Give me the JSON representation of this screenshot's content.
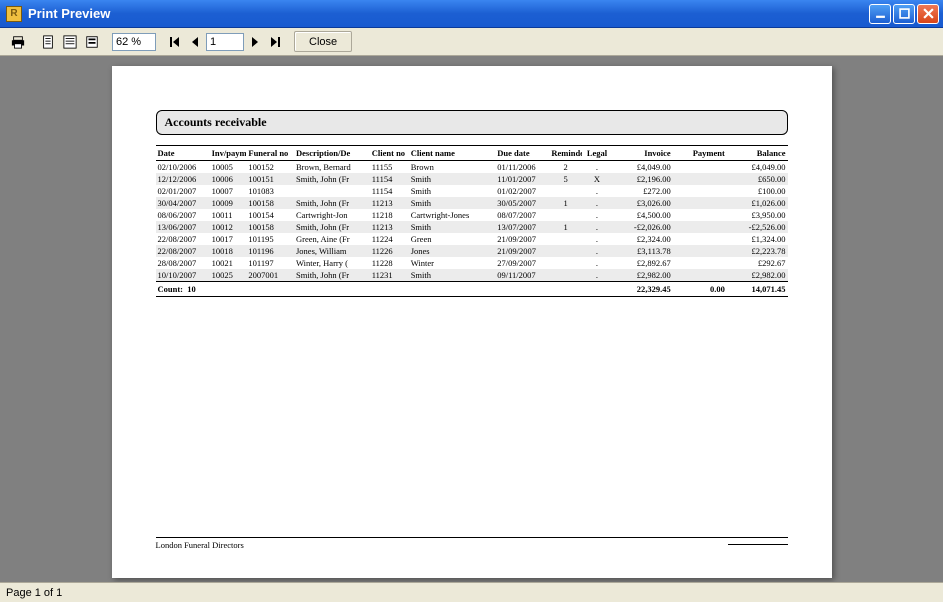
{
  "window": {
    "title": "Print Preview"
  },
  "toolbar": {
    "zoom": "62 %",
    "page": "1",
    "close_label": "Close"
  },
  "status": {
    "text": "Page 1 of 1"
  },
  "report": {
    "title": "Accounts receivable",
    "columns": [
      "Date",
      "Inv/paym.no",
      "Funeral no",
      "Description/De",
      "Client no",
      "Client name",
      "Due date",
      "Reminder",
      "Legal",
      "Invoice",
      "Payment",
      "Balance"
    ],
    "rows": [
      {
        "date": "02/10/2006",
        "inv": "10005",
        "funeral": "100152",
        "desc": "Brown, Bernard",
        "client": "11155",
        "cname": "Brown",
        "due": "01/11/2006",
        "rem": "2",
        "legal": ".",
        "invoice": "£4,049.00",
        "payment": "",
        "balance": "£4,049.00"
      },
      {
        "date": "12/12/2006",
        "inv": "10006",
        "funeral": "100151",
        "desc": "Smith, John (Fr",
        "client": "11154",
        "cname": "Smith",
        "due": "11/01/2007",
        "rem": "5",
        "legal": "X",
        "invoice": "£2,196.00",
        "payment": "",
        "balance": "£650.00"
      },
      {
        "date": "02/01/2007",
        "inv": "10007",
        "funeral": "101083",
        "desc": "",
        "client": "11154",
        "cname": "Smith",
        "due": "01/02/2007",
        "rem": "",
        "legal": ".",
        "invoice": "£272.00",
        "payment": "",
        "balance": "£100.00"
      },
      {
        "date": "30/04/2007",
        "inv": "10009",
        "funeral": "100158",
        "desc": "Smith, John (Fr",
        "client": "11213",
        "cname": "Smith",
        "due": "30/05/2007",
        "rem": "1",
        "legal": ".",
        "invoice": "£3,026.00",
        "payment": "",
        "balance": "£1,026.00"
      },
      {
        "date": "08/06/2007",
        "inv": "10011",
        "funeral": "100154",
        "desc": "Cartwright-Jon",
        "client": "11218",
        "cname": "Cartwright-Jones",
        "due": "08/07/2007",
        "rem": "",
        "legal": ".",
        "invoice": "£4,500.00",
        "payment": "",
        "balance": "£3,950.00"
      },
      {
        "date": "13/06/2007",
        "inv": "10012",
        "funeral": "100158",
        "desc": "Smith, John (Fr",
        "client": "11213",
        "cname": "Smith",
        "due": "13/07/2007",
        "rem": "1",
        "legal": ".",
        "invoice": "-£2,026.00",
        "payment": "",
        "balance": "-£2,526.00"
      },
      {
        "date": "22/08/2007",
        "inv": "10017",
        "funeral": "101195",
        "desc": "Green, Aine (Fr",
        "client": "11224",
        "cname": "Green",
        "due": "21/09/2007",
        "rem": "",
        "legal": ".",
        "invoice": "£2,324.00",
        "payment": "",
        "balance": "£1,324.00"
      },
      {
        "date": "22/08/2007",
        "inv": "10018",
        "funeral": "101196",
        "desc": "Jones, William",
        "client": "11226",
        "cname": "Jones",
        "due": "21/09/2007",
        "rem": "",
        "legal": ".",
        "invoice": "£3,113.78",
        "payment": "",
        "balance": "£2,223.78"
      },
      {
        "date": "28/08/2007",
        "inv": "10021",
        "funeral": "101197",
        "desc": "Winter, Harry (",
        "client": "11228",
        "cname": "Winter",
        "due": "27/09/2007",
        "rem": "",
        "legal": ".",
        "invoice": "£2,892.67",
        "payment": "",
        "balance": "£292.67"
      },
      {
        "date": "10/10/2007",
        "inv": "10025",
        "funeral": "2007001",
        "desc": "Smith, John (Fr",
        "client": "11231",
        "cname": "Smith",
        "due": "09/11/2007",
        "rem": "",
        "legal": ".",
        "invoice": "£2,982.00",
        "payment": "",
        "balance": "£2,982.00"
      }
    ],
    "totals": {
      "count_label": "Count:",
      "count": "10",
      "invoice": "22,329.45",
      "payment": "0.00",
      "balance": "14,071.45"
    },
    "footer_company": "London Funeral Directors"
  }
}
